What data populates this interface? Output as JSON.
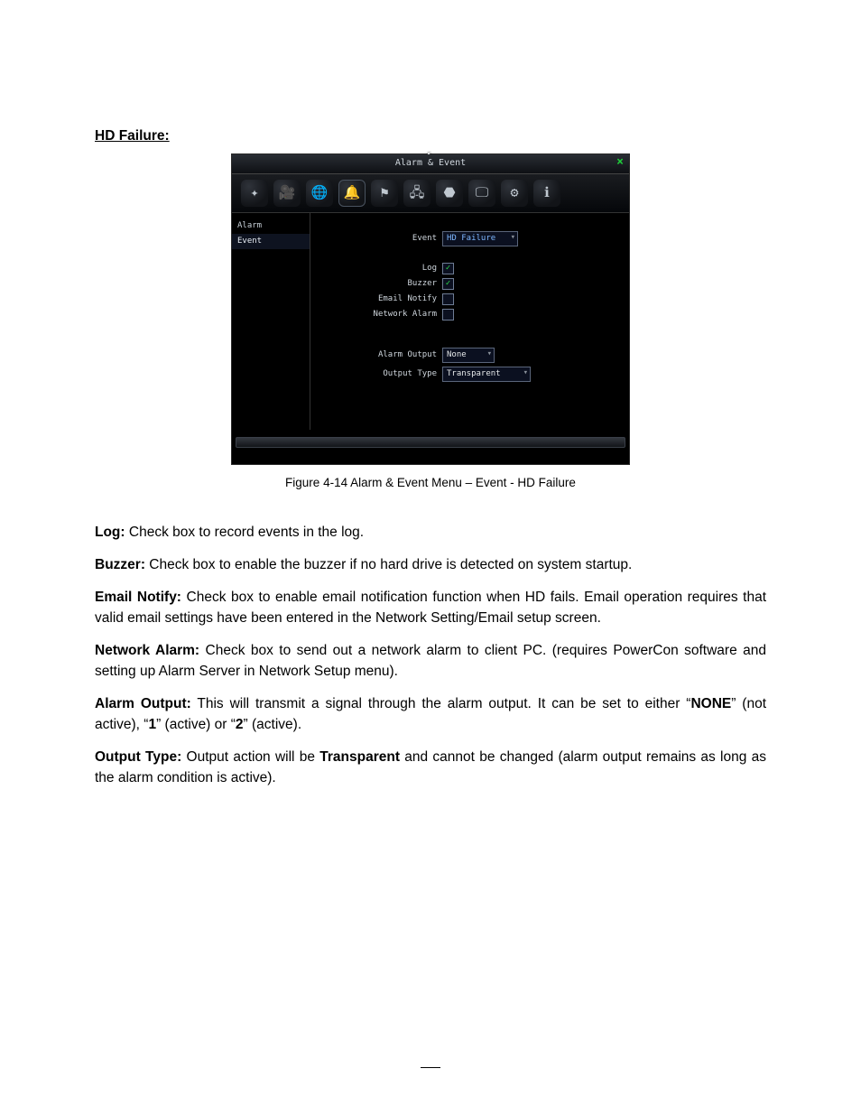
{
  "heading": "HD Failure:",
  "dvr": {
    "window_title": "Alarm & Event",
    "close_glyph": "×",
    "toolbar_icons": [
      {
        "name": "motion-icon",
        "glyph": "✦"
      },
      {
        "name": "video-icon",
        "glyph": "🎥"
      },
      {
        "name": "globe-icon",
        "glyph": "🌐"
      },
      {
        "name": "bell-icon",
        "glyph": "🔔"
      },
      {
        "name": "flag-icon",
        "glyph": "⚑"
      },
      {
        "name": "network-icon",
        "glyph": "🖧"
      },
      {
        "name": "sensor-icon",
        "glyph": "⬣"
      },
      {
        "name": "display-icon",
        "glyph": "🖵"
      },
      {
        "name": "settings-icon",
        "glyph": "⚙"
      },
      {
        "name": "info-icon",
        "glyph": "ℹ"
      }
    ],
    "sidebar": {
      "items": [
        "Alarm",
        "Event"
      ],
      "active_index": 1
    },
    "form": {
      "event_label": "Event",
      "event_value": "HD Failure",
      "log_label": "Log",
      "log_checked": true,
      "buzzer_label": "Buzzer",
      "buzzer_checked": true,
      "email_label": "Email Notify",
      "email_checked": false,
      "net_label": "Network Alarm",
      "net_checked": false,
      "alarm_output_label": "Alarm Output",
      "alarm_output_value": "None",
      "output_type_label": "Output Type",
      "output_type_value": "Transparent"
    }
  },
  "caption": "Figure 4-14  Alarm & Event Menu – Event - HD Failure",
  "paragraphs": {
    "log": {
      "lead": "Log:",
      "text": " Check box to record events in the log."
    },
    "buzzer": {
      "lead": "Buzzer:",
      "text": " Check box to enable the buzzer if no hard drive is detected on system startup."
    },
    "email": {
      "lead": "Email Notify:",
      "text": " Check box to enable email notification function when HD fails. Email operation requires that valid email settings have been entered in the Network Setting/Email setup screen."
    },
    "net": {
      "lead": "Network Alarm:",
      "text": " Check box to send out a network alarm to client PC. (requires PowerCon software and setting up Alarm Server in Network Setup menu)."
    },
    "alarm_out": {
      "lead": "Alarm Output:",
      "pre": " This will transmit a signal through the alarm output. It can be set to either “",
      "v1": "NONE",
      "mid1": "” (not active), “",
      "v2": "1",
      "mid2": "” (active) or “",
      "v3": "2",
      "post": "” (active)."
    },
    "out_type": {
      "lead": "Output Type:",
      "pre": " Output action will be ",
      "v1": "Transparent",
      "post": " and cannot be changed (alarm output remains as long as the alarm condition is active)."
    }
  }
}
